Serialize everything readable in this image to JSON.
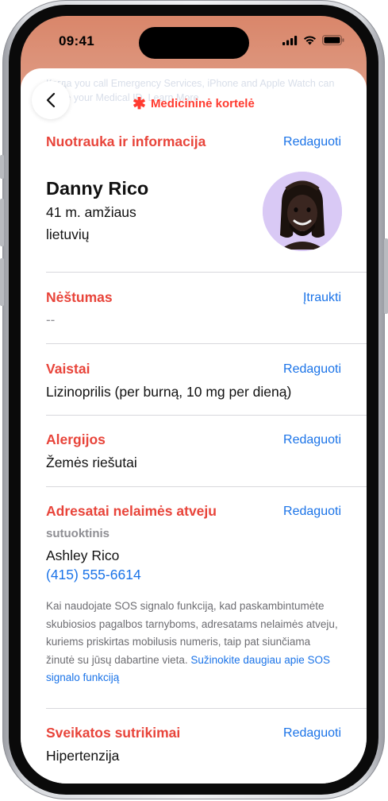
{
  "status_bar": {
    "time": "09:41"
  },
  "header": {
    "title": "Medicininė kortelė",
    "ghost_text": "Когда you call Emergency Services, iPhone and Apple Watch can share your Medical ID. Learn More"
  },
  "profile": {
    "section_title": "Nuotrauka ir informacija",
    "edit_label": "Redaguoti",
    "name": "Danny Rico",
    "age": "41 m. amžiaus",
    "nationality": "lietuvių"
  },
  "pregnancy": {
    "title": "Nėštumas",
    "add_label": "Įtraukti",
    "value": "--"
  },
  "medications": {
    "title": "Vaistai",
    "edit_label": "Redaguoti",
    "value": "Lizinoprilis (per burną, 10 mg per dieną)"
  },
  "allergies": {
    "title": "Alergijos",
    "edit_label": "Redaguoti",
    "value": "Žemės riešutai"
  },
  "emergency_contacts": {
    "title": "Adresatai nelaimės atveju",
    "edit_label": "Redaguoti",
    "relation": "sutuoktinis",
    "name": "Ashley Rico",
    "phone": "(415) 555-6614",
    "note": "Kai naudojate SOS signalo funkciją, kad paskambintumėte skubiosios pagalbos tarnyboms, adresatams nelaimės atveju, kuriems priskirtas mobilusis numeris, taip pat siunčiama žinutė su jūsų dabartine vieta.",
    "note_link": "Sužinokite daugiau apie SOS signalo funkciją"
  },
  "conditions": {
    "title": "Sveikatos sutrikimai",
    "edit_label": "Redaguoti",
    "value": "Hipertenzija"
  },
  "colors": {
    "accent_red": "#e8443a",
    "link_blue": "#1a73e8"
  },
  "icons": [
    "signal-icon",
    "wifi-icon",
    "battery-icon",
    "chevron-left-icon",
    "asterisk-icon",
    "memoji-avatar"
  ]
}
